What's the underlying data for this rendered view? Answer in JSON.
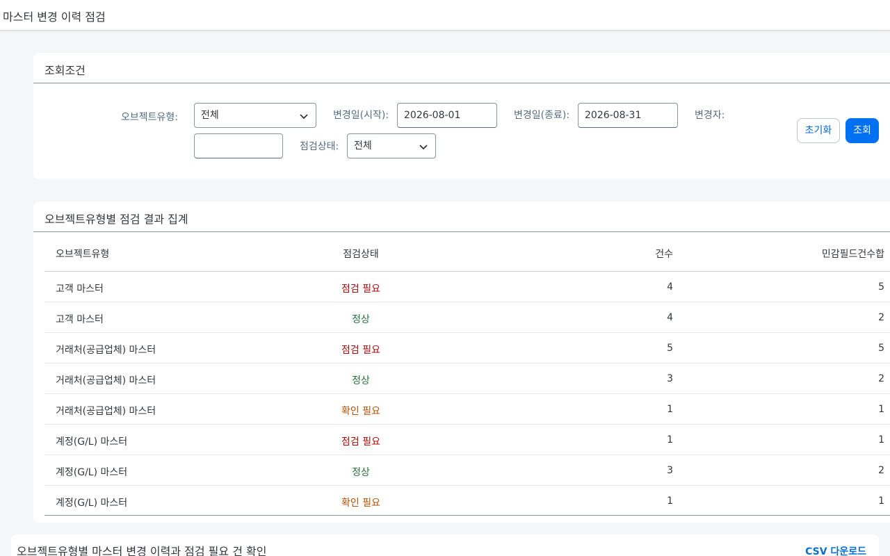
{
  "header": {
    "title": "마스터 변경 이력 점검"
  },
  "filters": {
    "title": "조회조건",
    "object_type": {
      "label": "오브젝트유형:",
      "value": "전체"
    },
    "date_from": {
      "label": "변경일(시작):",
      "value": "2026-08-01"
    },
    "date_to": {
      "label": "변경일(종료):",
      "value": "2026-08-31"
    },
    "changed_by": {
      "label": "변경자:",
      "value": ""
    },
    "check_status": {
      "label": "점검상태:",
      "value": "전체"
    },
    "reset_label": "초기화",
    "search_label": "조회"
  },
  "summary": {
    "title": "오브젝트유형별 점검 결과 집계",
    "columns": [
      "오브젝트유형",
      "점검상태",
      "건수",
      "민감필드건수합"
    ],
    "rows": [
      {
        "type": "고객 마스터",
        "status": "점검 필요",
        "status_color": "#aa0808",
        "count": "4",
        "sensitive_sum": "5"
      },
      {
        "type": "고객 마스터",
        "status": "정상",
        "status_color": "#256f3a",
        "count": "4",
        "sensitive_sum": "2"
      },
      {
        "type": "거래처(공급업체) 마스터",
        "status": "점검 필요",
        "status_color": "#aa0808",
        "count": "5",
        "sensitive_sum": "5"
      },
      {
        "type": "거래처(공급업체) 마스터",
        "status": "정상",
        "status_color": "#256f3a",
        "count": "3",
        "sensitive_sum": "2"
      },
      {
        "type": "거래처(공급업체) 마스터",
        "status": "확인 필요",
        "status_color": "#b44f00",
        "count": "1",
        "sensitive_sum": "1"
      },
      {
        "type": "계정(G/L) 마스터",
        "status": "점검 필요",
        "status_color": "#aa0808",
        "count": "1",
        "sensitive_sum": "1"
      },
      {
        "type": "계정(G/L) 마스터",
        "status": "정상",
        "status_color": "#256f3a",
        "count": "3",
        "sensitive_sum": "2"
      },
      {
        "type": "계정(G/L) 마스터",
        "status": "확인 필요",
        "status_color": "#b44f00",
        "count": "1",
        "sensitive_sum": "1"
      }
    ]
  },
  "detail": {
    "title": "오브젝트유형별 마스터 변경 이력과 점검 필요 건 확인",
    "csv_label": "CSV 다운로드"
  }
}
